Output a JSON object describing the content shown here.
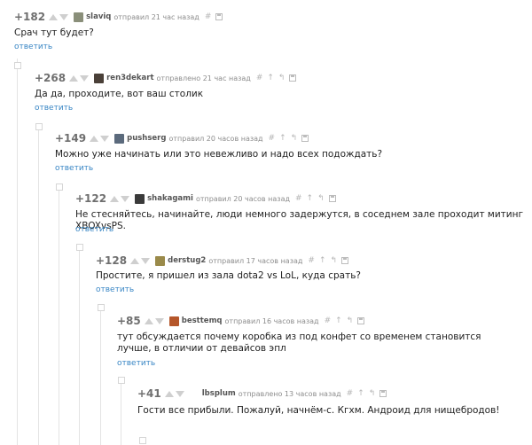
{
  "reply_label": "ответить",
  "comments": [
    {
      "rating": "+182",
      "user": "slaviq",
      "time": "отправил 21 час назад",
      "text": "Срач тут будет?",
      "avatar_color": "#8a8f7a"
    },
    {
      "rating": "+268",
      "user": "ren3dekart",
      "time": "отправлено 21 час назад",
      "text": "Да да, проходите, вот ваш столик",
      "avatar_color": "#4a4038"
    },
    {
      "rating": "+149",
      "user": "pushserg",
      "time": "отправил 20 часов назад",
      "text": "Можно уже начинать или это невежливо и надо всех подождать?",
      "avatar_color": "#5b6a7c"
    },
    {
      "rating": "+122",
      "user": "shakagami",
      "time": "отправил 20 часов назад",
      "text": "Не стесняйтесь, начинайте, люди немного задержутся, в соседнем зале проходит митинг XBOXvsPS.",
      "avatar_color": "#3a3a3a"
    },
    {
      "rating": "+128",
      "user": "derstug2",
      "time": "отправил 17 часов назад",
      "text": "Простите, я пришел из зала dota2 vs LoL, куда срать?",
      "avatar_color": "#9a8a4a"
    },
    {
      "rating": "+85",
      "user": "besttemq",
      "time": "отправил 16 часов назад",
      "text": "тут обсуждается почему коробка из под конфет со временем становится лучше, в отличии от девайсов эпл",
      "avatar_color": "#b5562a"
    },
    {
      "rating": "+41",
      "user": "lbsplum",
      "time": "отправлено 13 часов назад",
      "text": "Гости все прибыли. Пожалуй, начнём-с. Кгхм. Андроид для нищебродов!",
      "avatar_color": ""
    }
  ]
}
